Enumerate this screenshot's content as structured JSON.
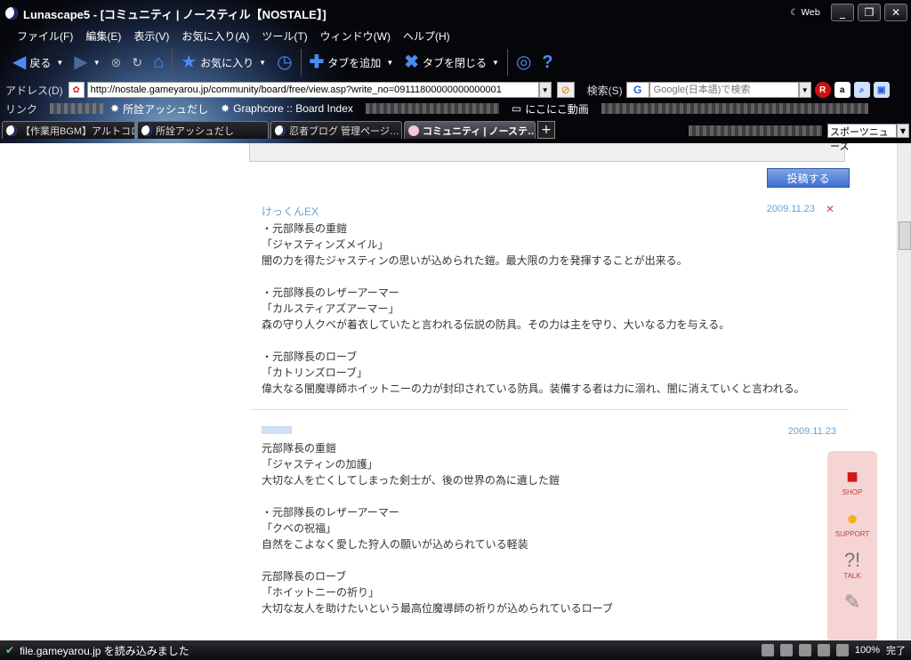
{
  "window": {
    "title": "Lunascape5 - [コミュニティ | ノースティル【NOSTALE】]",
    "web_label": "Web",
    "controls": [
      "_",
      "❐",
      "✕"
    ]
  },
  "menu": [
    "ファイル(F)",
    "編集(E)",
    "表示(V)",
    "お気に入り(A)",
    "ツール(T)",
    "ウィンドウ(W)",
    "ヘルプ(H)"
  ],
  "toolbar": {
    "back": "戻る",
    "favorites": "お気に入り",
    "add_tab": "タブを追加",
    "close_tab": "タブを閉じる"
  },
  "address": {
    "label": "アドレス(D)",
    "url": "http://nostale.gameyarou.jp/community/board/free/view.asp?write_no=09111800000000000001",
    "search_label": "検索(S)",
    "search_placeholder": "Google(日本語)で検索"
  },
  "links": {
    "label": "リンク",
    "items": [
      "所詮アッシュだし",
      "Graphcore :: Board Index",
      "にこにこ動画"
    ]
  },
  "tabs": [
    {
      "label": "【作業用BGM】アルトコロ…",
      "active": false
    },
    {
      "label": "所詮アッシュだし",
      "active": false
    },
    {
      "label": "忍者ブログ 管理ページ…",
      "active": false
    },
    {
      "label": "コミュニティ | ノーステ…",
      "active": true
    }
  ],
  "news_select": "スポーツニュース",
  "content": {
    "post_button": "投稿する",
    "comments": [
      {
        "author": "けっくんEX",
        "date": "2009.11.23",
        "delete": "✕",
        "lines": [
          "・元部隊長の重鎧",
          "「ジャスティンズメイル」",
          "闇の力を得たジャスティンの思いが込められた鎧。最大限の力を発揮することが出来る。",
          "",
          "・元部隊長のレザーアーマー",
          "「カルスティアズアーマー」",
          "森の守り人クベが着衣していたと言われる伝説の防具。その力は主を守り、大いなる力を与える。",
          "",
          "・元部隊長のローブ",
          "「カトリンズローブ」",
          "偉大なる闇魔導師ホイットニーの力が封印されている防具。装備する者は力に溺れ、闇に消えていくと言われる。"
        ]
      },
      {
        "author": "",
        "date": "2009.11.23",
        "lines": [
          "元部隊長の重鎧",
          "「ジャスティンの加護」",
          "大切な人を亡くしてしまった剣士が、後の世界の為に遺した鎧",
          "",
          "・元部隊長のレザーアーマー",
          "「クベの祝福」",
          "自然をこよなく愛した狩人の願いが込められている軽装",
          "",
          "元部隊長のローブ",
          "「ホイットニーの祈り」",
          "大切な友人を助けたいという最高位魔導師の祈りが込められているローブ"
        ]
      }
    ],
    "side_panel": [
      "SHOP",
      "SUPPORT",
      "TALK"
    ]
  },
  "status": {
    "message": "file.gameyarou.jp を読み込みました",
    "zoom": "100%",
    "done": "完了"
  }
}
